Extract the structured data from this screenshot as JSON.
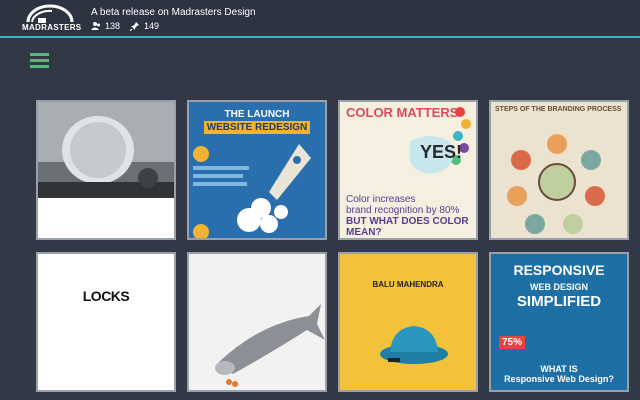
{
  "header": {
    "logo_text": "MADRASTERS",
    "title": "A beta release on Madrasters Design",
    "followers": "138",
    "pins": "149"
  },
  "grid": {
    "card2": {
      "title_line1": "THE LAUNCH",
      "title_line2": "WEBSITE REDESIGN"
    },
    "card3": {
      "title": "COLOR MATTERS",
      "yes": "YES!",
      "line1": "Color increases",
      "line2": "brand recognition by 80%",
      "line3": "BUT WHAT DOES COLOR MEAN?"
    },
    "card4": {
      "title": "STEPS OF THE BRANDING PROCESS"
    },
    "card5": {
      "text": "LOCKS"
    },
    "card7": {
      "text": "BALU MAHENDRA"
    },
    "card8": {
      "line1": "RESPONSIVE",
      "line2": "WEB DESIGN",
      "line3": "SIMPLIFIED",
      "pct": "75%",
      "q1": "WHAT IS",
      "q2": "Responsive Web Design?"
    }
  }
}
